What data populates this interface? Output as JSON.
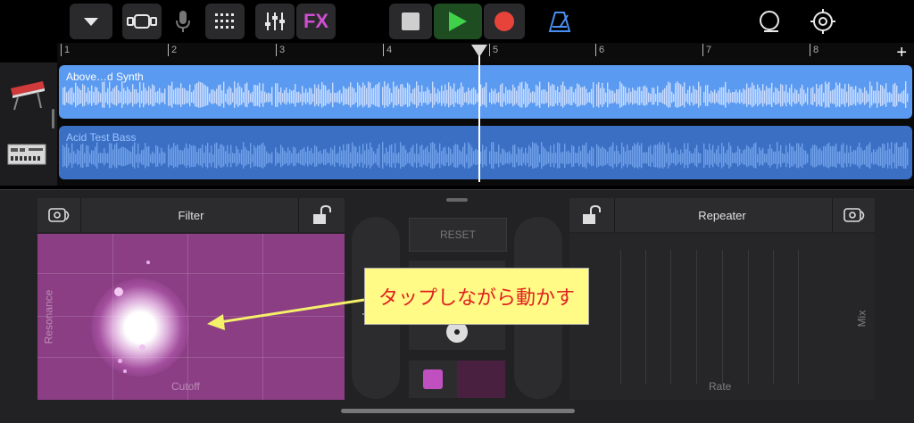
{
  "toolbar": {
    "buttons": [
      {
        "name": "menu-dropdown-button",
        "icon": "chevron-down-icon"
      },
      {
        "name": "view-toggle-button",
        "icon": "track-view-icon"
      },
      {
        "name": "microphone-button",
        "icon": "microphone-icon"
      },
      {
        "name": "grid-view-button",
        "icon": "grid-icon"
      },
      {
        "name": "mixer-button",
        "icon": "sliders-icon"
      },
      {
        "name": "fx-button",
        "label": "FX"
      },
      {
        "name": "stop-button",
        "icon": "stop-icon"
      },
      {
        "name": "play-button",
        "icon": "play-icon"
      },
      {
        "name": "record-button",
        "icon": "record-icon"
      },
      {
        "name": "metronome-button",
        "icon": "metronome-icon"
      },
      {
        "name": "loop-browser-button",
        "icon": "loop-icon"
      },
      {
        "name": "settings-button",
        "icon": "gear-icon"
      }
    ],
    "fx_label": "FX",
    "colors": {
      "accent_fx": "#d04fd0",
      "play": "#3fd14a",
      "record": "#e8433a",
      "metronome": "#4a8ff0"
    }
  },
  "ruler": {
    "bars": [
      "1",
      "2",
      "3",
      "4",
      "5",
      "6",
      "7",
      "8"
    ],
    "add_label": "+"
  },
  "tracks": [
    {
      "name": "Above…d Synth",
      "instrument_icon": "synth-keyboard-icon",
      "color": "#5a9af0"
    },
    {
      "name": "Acid Test Bass",
      "instrument_icon": "drum-machine-icon",
      "color": "#3a6fc4"
    }
  ],
  "filter_panel": {
    "title": "Filter",
    "x_axis": "Cutoff",
    "y_axis": "Resonance",
    "color": "#8b3e84",
    "left_icon": "rewind-loop-icon",
    "right_icon": "unlock-icon"
  },
  "center_controls": {
    "reset_label": "RESET",
    "vinyl_icon": "vinyl-scratch-icon",
    "reverse_icon": "reverse-icon",
    "color_swatch": "#c050c0"
  },
  "repeater_panel": {
    "title": "Repeater",
    "x_axis": "Rate",
    "y_axis": "Mix",
    "left_icon": "unlock-icon",
    "right_icon": "rewind-loop-icon"
  },
  "annotation": {
    "text": "タップしながら動かす"
  }
}
